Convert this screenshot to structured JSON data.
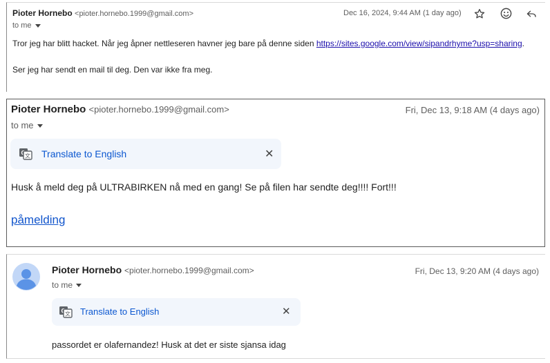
{
  "email1": {
    "sender_name": "Pioter Hornebo",
    "sender_email": "<pioter.hornebo.1999@gmail.com>",
    "date": "Dec 16, 2024, 9:44 AM (1 day ago)",
    "to_me": "to me",
    "body_prefix": "Tror jeg har blitt hacket. Når jeg åpner nettleseren havner jeg bare på denne siden ",
    "body_link": "https://sites.google.com/view/sipandrhyme?usp=sharing",
    "body_suffix": ".",
    "body_line2": "Ser jeg har sendt en mail til deg. Den var ikke fra meg.",
    "icons": {
      "star": "star-icon",
      "emoji": "emoji-icon",
      "reply": "reply-icon"
    }
  },
  "email2": {
    "sender_name": "Pioter Hornebo",
    "sender_email": "<pioter.hornebo.1999@gmail.com>",
    "date": "Fri, Dec 13, 9:18 AM (4 days ago)",
    "to_me": "to me",
    "translate_label": "Translate to English",
    "close_glyph": "✕",
    "body": "Husk å meld deg på ULTRABIRKEN nå med en gang! Se på filen har sendte deg!!!! Fort!!!",
    "link": "påmelding"
  },
  "email3": {
    "sender_name": "Pioter Hornebo",
    "sender_email": "<pioter.hornebo.1999@gmail.com>",
    "date": "Fri, Dec 13, 9:20 AM (4 days ago)",
    "to_me": "to me",
    "translate_label": "Translate to English",
    "close_glyph": "✕",
    "body": "passordet er olafernandez! Husk at det er siste sjansa idag",
    "avatar_color": "#5b93e6"
  }
}
